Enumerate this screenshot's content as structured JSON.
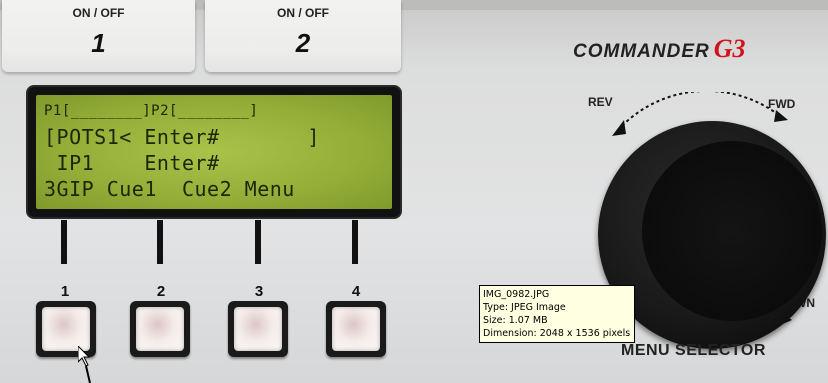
{
  "top_keys": [
    {
      "onoff": "ON / OFF",
      "number": "1"
    },
    {
      "onoff": "ON / OFF",
      "number": "2"
    }
  ],
  "brand": {
    "name": "COMMANDER",
    "model": "G3",
    "model_color": "#d2121b"
  },
  "lcd": {
    "line1": "P1[________]P2[________]",
    "line2": "[POTS1< Enter#       ]",
    "line3": " IP1    Enter#",
    "line4": "3GIP Cue1  Cue2 Menu",
    "background_color": "#9ab63d"
  },
  "soft_keys": [
    {
      "number": "1"
    },
    {
      "number": "2"
    },
    {
      "number": "3"
    },
    {
      "number": "4"
    }
  ],
  "knob": {
    "rev_label": "REV",
    "fwd_label": "FWD",
    "down_label": "DOWN",
    "title": "MENU SELECTOR"
  },
  "tooltip": {
    "filename": "IMG_0982.JPG",
    "type": "Type: JPEG Image",
    "size": "Size: 1.07 MB",
    "dimension": "Dimension: 2048 x 1536 pixels"
  },
  "icons": {
    "cursor": "arrow-pointer-icon",
    "rev_arrow": "ccw-arrow-icon",
    "fwd_arrow": "cw-arrow-icon"
  }
}
